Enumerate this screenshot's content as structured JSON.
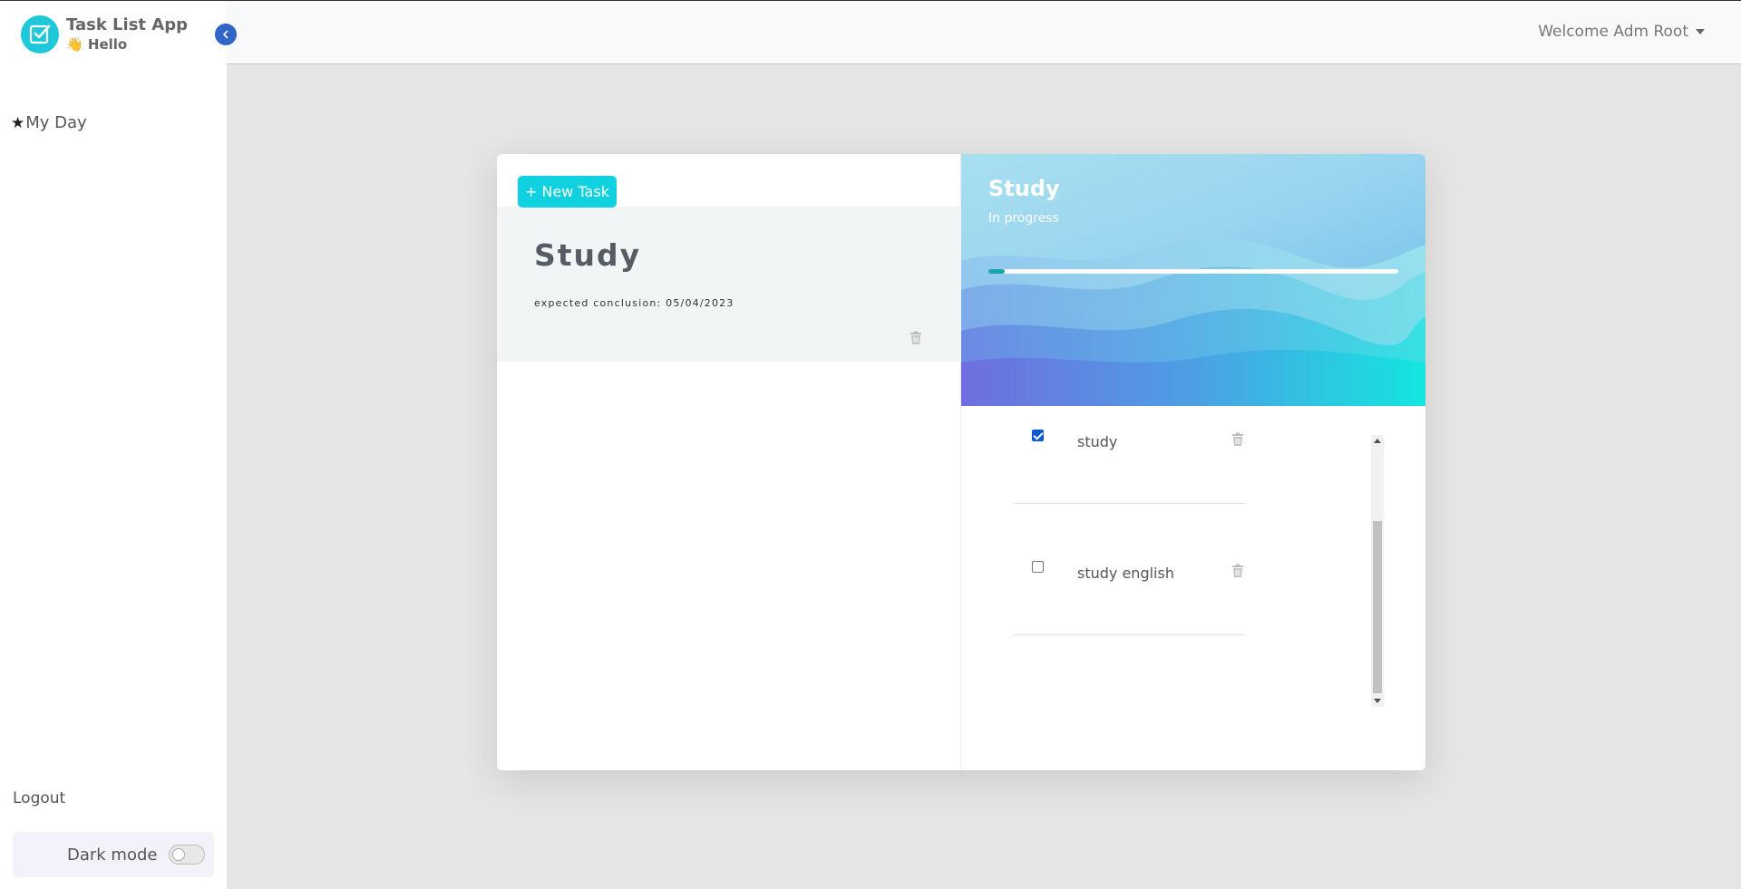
{
  "app": {
    "title": "Task List App",
    "greeting": "👋 Hello",
    "brand_color": "#1ec8d8"
  },
  "sidebar": {
    "items": [
      {
        "label": "My Day",
        "icon": "star-icon"
      }
    ],
    "logout_label": "Logout",
    "dark_mode_label": "Dark mode",
    "dark_mode_on": false
  },
  "header": {
    "welcome": "Welcome Adm Root"
  },
  "tasks": {
    "new_task_label": "+ New Task",
    "list": [
      {
        "title": "Study",
        "expected": "expected conclusion: 05/04/2023"
      }
    ]
  },
  "detail": {
    "title": "Study",
    "status": "In progress",
    "progress_percent": 4,
    "accent": "#1aa5a8",
    "subtasks": [
      {
        "label": "study",
        "done": true
      },
      {
        "label": "study english",
        "done": false
      }
    ]
  }
}
